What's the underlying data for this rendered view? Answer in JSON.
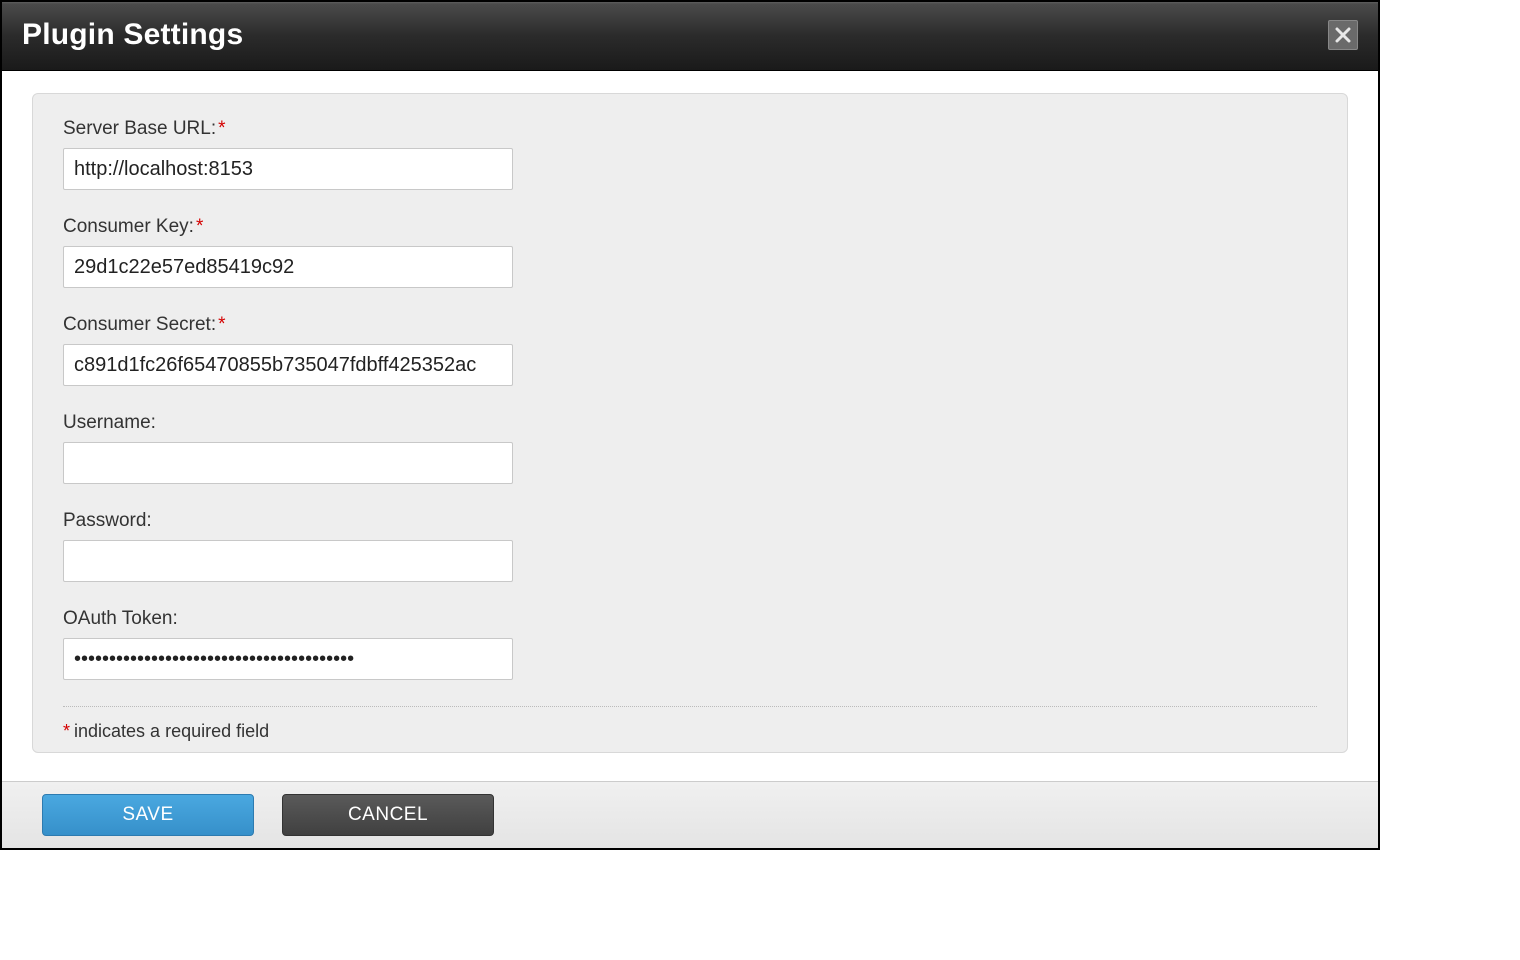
{
  "dialog": {
    "title": "Plugin Settings",
    "close_icon": "close-icon"
  },
  "form": {
    "fields": [
      {
        "label": "Server Base URL:",
        "required": true,
        "value": "http://localhost:8153",
        "type": "text",
        "name": "server-base-url"
      },
      {
        "label": "Consumer Key:",
        "required": true,
        "value": "29d1c22e57ed85419c92",
        "type": "text",
        "name": "consumer-key"
      },
      {
        "label": "Consumer Secret:",
        "required": true,
        "value": "c891d1fc26f65470855b735047fdbff425352ac",
        "type": "text",
        "name": "consumer-secret"
      },
      {
        "label": "Username:",
        "required": false,
        "value": "",
        "type": "text",
        "name": "username"
      },
      {
        "label": "Password:",
        "required": false,
        "value": "",
        "type": "password",
        "name": "password"
      },
      {
        "label": "OAuth Token:",
        "required": false,
        "value": "••••••••••••••••••••••••••••••••••••••••",
        "type": "password",
        "name": "oauth-token"
      }
    ],
    "required_marker": "*",
    "required_note": "indicates a required field"
  },
  "footer": {
    "save_label": "SAVE",
    "cancel_label": "CANCEL"
  }
}
